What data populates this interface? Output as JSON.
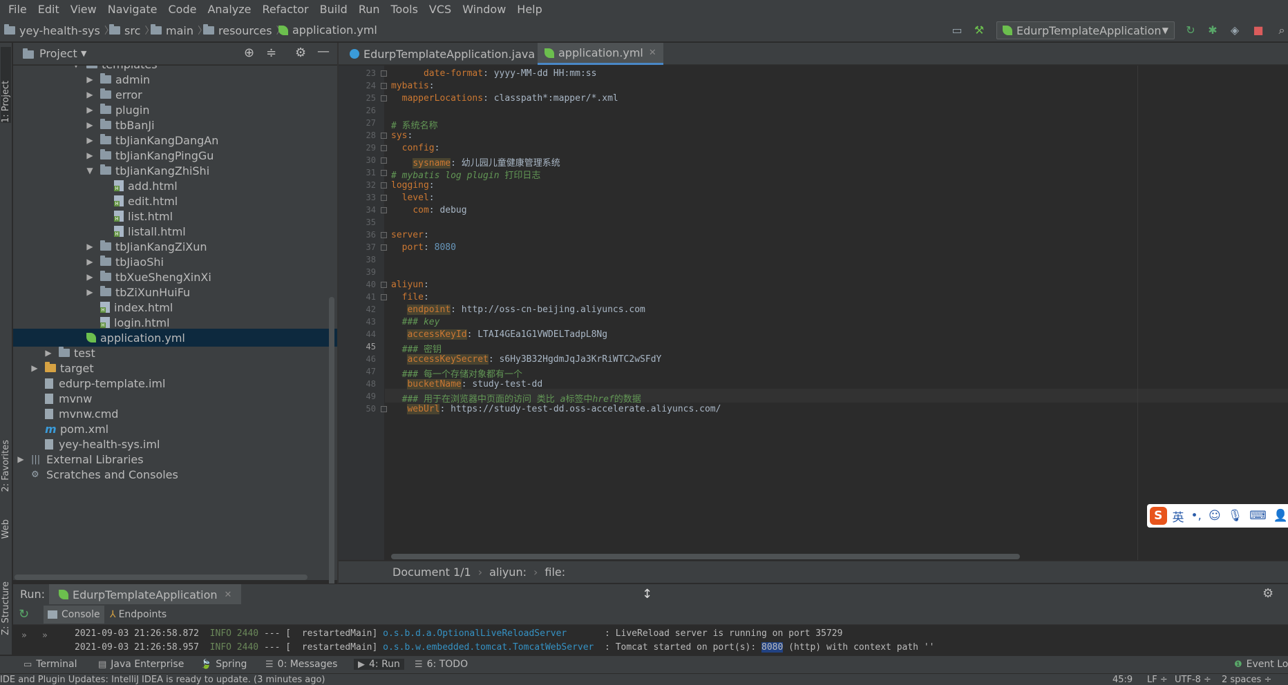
{
  "menu": [
    "File",
    "Edit",
    "View",
    "Navigate",
    "Code",
    "Analyze",
    "Refactor",
    "Build",
    "Run",
    "Tools",
    "VCS",
    "Window",
    "Help"
  ],
  "breadcrumbs": [
    "yey-health-sys",
    "src",
    "main",
    "resources",
    "application.yml"
  ],
  "run_config": "EdurpTemplateApplication",
  "left_stripe": {
    "project": "1: Project",
    "favorites": "2: Favorites",
    "web": "Web",
    "structure": "Z: Structure"
  },
  "project_panel": {
    "title": "Project",
    "tree": [
      {
        "label": "templates",
        "type": "folder",
        "expanded": true
      },
      {
        "label": "admin",
        "type": "folder"
      },
      {
        "label": "error",
        "type": "folder"
      },
      {
        "label": "plugin",
        "type": "folder"
      },
      {
        "label": "tbBanJi",
        "type": "folder"
      },
      {
        "label": "tbJianKangDangAn",
        "type": "folder"
      },
      {
        "label": "tbJianKangPingGu",
        "type": "folder"
      },
      {
        "label": "tbJianKangZhiShi",
        "type": "folder",
        "expanded": true
      },
      {
        "label": "add.html",
        "type": "html"
      },
      {
        "label": "edit.html",
        "type": "html"
      },
      {
        "label": "list.html",
        "type": "html"
      },
      {
        "label": "listall.html",
        "type": "html"
      },
      {
        "label": "tbJianKangZiXun",
        "type": "folder"
      },
      {
        "label": "tbJiaoShi",
        "type": "folder"
      },
      {
        "label": "tbXueShengXinXi",
        "type": "folder"
      },
      {
        "label": "tbZiXunHuiFu",
        "type": "folder"
      },
      {
        "label": "index.html",
        "type": "html"
      },
      {
        "label": "login.html",
        "type": "html"
      },
      {
        "label": "application.yml",
        "type": "yml",
        "selected": true
      },
      {
        "label": "test",
        "type": "folder"
      },
      {
        "label": "target",
        "type": "folder-orange"
      },
      {
        "label": "edurp-template.iml",
        "type": "file"
      },
      {
        "label": "mvnw",
        "type": "file"
      },
      {
        "label": "mvnw.cmd",
        "type": "file"
      },
      {
        "label": "pom.xml",
        "type": "maven"
      },
      {
        "label": "yey-health-sys.iml",
        "type": "file"
      },
      {
        "label": "External Libraries",
        "type": "lib"
      },
      {
        "label": "Scratches and Consoles",
        "type": "scratch"
      }
    ]
  },
  "editor_tabs": [
    {
      "label": "EdurpTemplateApplication.java",
      "active": false
    },
    {
      "label": "application.yml",
      "active": true
    }
  ],
  "code": {
    "current_line": "45",
    "lines": [
      {
        "n": "23",
        "parts": [
          [
            "      ",
            ""
          ],
          [
            "date-format",
            "key"
          ],
          [
            ": yyyy-MM-dd HH:mm:ss",
            "val"
          ]
        ]
      },
      {
        "n": "24",
        "parts": [
          [
            "mybatis",
            "key"
          ],
          [
            ":",
            "val"
          ]
        ]
      },
      {
        "n": "25",
        "parts": [
          [
            "  ",
            ""
          ],
          [
            "mapperLocations",
            "key"
          ],
          [
            ": classpath*:mapper/*.xml",
            "val"
          ]
        ]
      },
      {
        "n": "26",
        "parts": []
      },
      {
        "n": "27",
        "parts": [
          [
            "# 系统名称",
            "cmt"
          ]
        ]
      },
      {
        "n": "28",
        "parts": [
          [
            "sys",
            "key"
          ],
          [
            ":",
            "val"
          ]
        ]
      },
      {
        "n": "29",
        "parts": [
          [
            "  ",
            ""
          ],
          [
            "config",
            "key"
          ],
          [
            ":",
            "val"
          ]
        ]
      },
      {
        "n": "30",
        "parts": [
          [
            "    ",
            ""
          ],
          [
            "sysname",
            "keyhl"
          ],
          [
            ": 幼儿园儿童健康管理系统",
            "val"
          ]
        ]
      },
      {
        "n": "31",
        "parts": [
          [
            "# mybatis log plugin ",
            "cmti"
          ],
          [
            "打印日志",
            "cmt"
          ]
        ]
      },
      {
        "n": "32",
        "parts": [
          [
            "logging",
            "key"
          ],
          [
            ":",
            "val"
          ]
        ]
      },
      {
        "n": "33",
        "parts": [
          [
            "  ",
            ""
          ],
          [
            "level",
            "key"
          ],
          [
            ":",
            "val"
          ]
        ]
      },
      {
        "n": "34",
        "parts": [
          [
            "    ",
            ""
          ],
          [
            "com",
            "key"
          ],
          [
            ": debug",
            "val"
          ]
        ]
      },
      {
        "n": "35",
        "parts": []
      },
      {
        "n": "36",
        "parts": [
          [
            "server",
            "key"
          ],
          [
            ":",
            "val"
          ]
        ]
      },
      {
        "n": "37",
        "parts": [
          [
            "  ",
            ""
          ],
          [
            "port",
            "key"
          ],
          [
            ": ",
            "val"
          ],
          [
            "8080",
            "num"
          ]
        ]
      },
      {
        "n": "38",
        "parts": []
      },
      {
        "n": "39",
        "parts": []
      },
      {
        "n": "40",
        "parts": [
          [
            "aliyun",
            "key"
          ],
          [
            ":",
            "val"
          ]
        ]
      },
      {
        "n": "41",
        "parts": [
          [
            "  ",
            ""
          ],
          [
            "file",
            "key"
          ],
          [
            ":",
            "val"
          ]
        ]
      },
      {
        "n": "42",
        "parts": [
          [
            "   ",
            ""
          ],
          [
            "endpoint",
            "keyhl"
          ],
          [
            ": http://oss-cn-beijing.aliyuncs.com",
            "val"
          ]
        ]
      },
      {
        "n": "43",
        "parts": [
          [
            "  ",
            ""
          ],
          [
            "### key",
            "cmti"
          ]
        ]
      },
      {
        "n": "44",
        "parts": [
          [
            "   ",
            ""
          ],
          [
            "accessKeyId",
            "keyhl"
          ],
          [
            ": LTAI4GEa1G1VWDELTadpL8Ng",
            "val"
          ]
        ]
      },
      {
        "n": "45",
        "parts": [
          [
            "  ",
            ""
          ],
          [
            "### 密钥",
            "cmt"
          ]
        ]
      },
      {
        "n": "46",
        "parts": [
          [
            "   ",
            ""
          ],
          [
            "accessKeySecret",
            "keyhl"
          ],
          [
            ": s6Hy3B32HgdmJqJa3KrRiWTC2wSFdY",
            "val"
          ]
        ]
      },
      {
        "n": "47",
        "parts": [
          [
            "  ",
            ""
          ],
          [
            "### 每一个存储对象都有一个",
            "cmt"
          ]
        ]
      },
      {
        "n": "48",
        "parts": [
          [
            "   ",
            ""
          ],
          [
            "bucketName",
            "keyhl"
          ],
          [
            ": study-test-dd",
            "val"
          ]
        ]
      },
      {
        "n": "49",
        "parts": [
          [
            "  ",
            ""
          ],
          [
            "### 用于在浏览器中页面的访问 类比 ",
            "cmt"
          ],
          [
            "a",
            "cmti"
          ],
          [
            "标签中",
            "cmt"
          ],
          [
            "href",
            "cmti"
          ],
          [
            "的数据",
            "cmt"
          ]
        ]
      },
      {
        "n": "50",
        "parts": [
          [
            "   ",
            ""
          ],
          [
            "webUrl",
            "keyhl"
          ],
          [
            ": https://study-test-dd.oss-accelerate.aliyuncs.com/",
            "val"
          ]
        ]
      }
    ]
  },
  "editor_breadcrumb": [
    "Document 1/1",
    "aliyun:",
    "file:"
  ],
  "ime": {
    "logo": "S",
    "lang": "英"
  },
  "run_panel": {
    "label": "Run:",
    "tab": "EdurpTemplateApplication",
    "subtabs": [
      "Console",
      "Endpoints"
    ],
    "console_lines": [
      {
        "time": "2021-09-03 21:26:58.872",
        "level": "INFO",
        "pid": "2440",
        "thread": "--- [  restartedMain]",
        "logger": "o.s.b.d.a.OptionalLiveReloadServer      ",
        "msg": " : LiveReload server is running on port 35729"
      },
      {
        "time": "2021-09-03 21:26:58.957",
        "level": "INFO",
        "pid": "2440",
        "thread": "--- [  restartedMain]",
        "logger": "o.s.b.w.embedded.tomcat.TomcatWebServer ",
        "msg_pre": " : Tomcat started on port(s): ",
        "port": "8080",
        "msg_post": " (http) with context path ''"
      }
    ]
  },
  "bottom_tools": [
    {
      "label": "Terminal",
      "icon": "terminal-icon"
    },
    {
      "label": "Java Enterprise",
      "icon": "java-enterprise-icon"
    },
    {
      "label": "Spring",
      "icon": "spring-icon"
    },
    {
      "label": "0: Messages",
      "icon": "messages-icon"
    },
    {
      "label": "4: Run",
      "icon": "run-icon"
    },
    {
      "label": "6: TODO",
      "icon": "todo-icon"
    }
  ],
  "event_log": "Event Lo",
  "status": {
    "message": "IDE and Plugin Updates: IntelliJ IDEA is ready to update. (3 minutes ago)",
    "position": "45:9",
    "line_sep": "LF ÷",
    "encoding": "UTF-8 ÷",
    "indent": "2 spaces ÷"
  },
  "colors": {
    "accent": "#4a88c7",
    "selection": "#0d293e",
    "keyword": "#cc7832",
    "comment": "#629755",
    "number": "#6897bb"
  }
}
